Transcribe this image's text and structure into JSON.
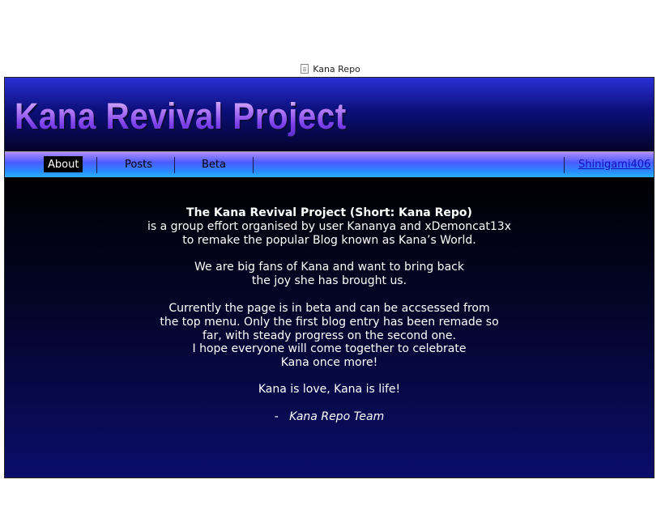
{
  "tab": {
    "title": "Kana Repo",
    "icon": "document-icon"
  },
  "header": {
    "title": "Kana Revival Project"
  },
  "nav": {
    "items": [
      "About",
      "Posts",
      "Beta"
    ],
    "active": "About",
    "user": "Shinigami406"
  },
  "content": {
    "intro": [
      "The Kana Revival Project (Short: Kana Repo)",
      "is a group effort organised by user Kananya and  xDemoncat13x",
      "to remake the popular Blog known as Kana’s World."
    ],
    "fans": [
      "We are big fans of Kana and want to bring back",
      "the joy she has brought us."
    ],
    "status": [
      "Currently the page is in beta and can be accsessed from",
      "the top menu. Only the first blog entry has been remade so",
      "far, with steady progress on the second one.",
      "I hope everyone will come together to celebrate",
      "Kana once more!"
    ],
    "motto": "Kana is love, Kana is life!",
    "signature_dash": "-",
    "signature_name": "Kana Repo Team"
  },
  "colors": {
    "banner_top": "#2a2fd6",
    "banner_bottom": "#03032a",
    "nav_top": "#b08cff",
    "nav_bottom": "#2ab6ff",
    "content_bg": "#04052a",
    "text": "#ffffff"
  }
}
